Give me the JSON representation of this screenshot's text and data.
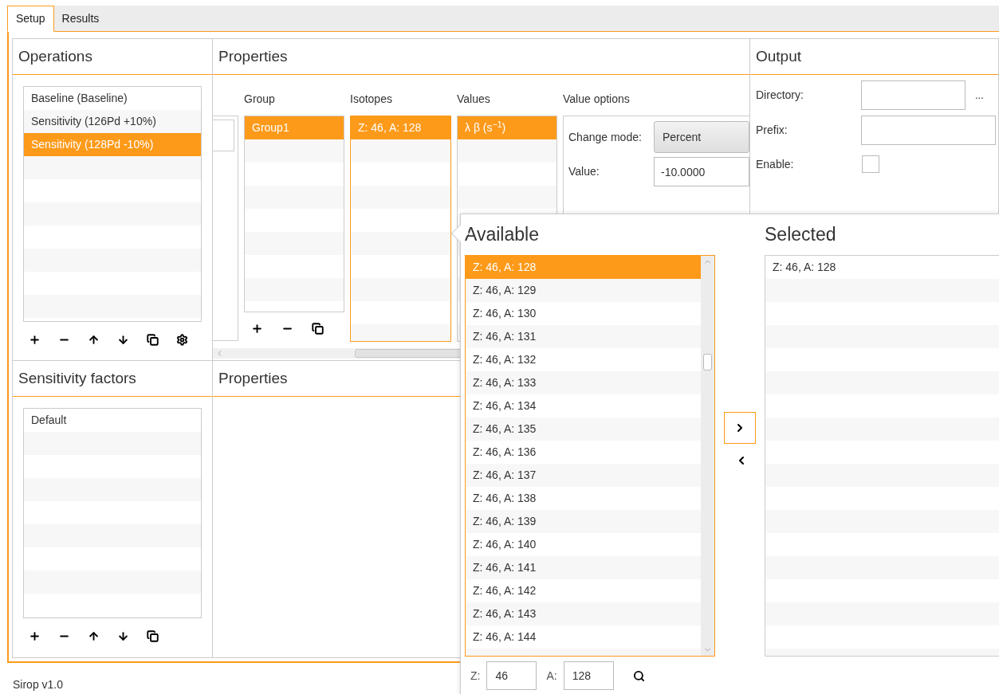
{
  "tabs": [
    {
      "label": "Setup",
      "selected": true
    },
    {
      "label": "Results",
      "selected": false
    }
  ],
  "operations": {
    "title": "Operations",
    "items": [
      {
        "label": "Baseline (Baseline)",
        "selected": false
      },
      {
        "label": "Sensitivity (126Pd +10%)",
        "selected": false
      },
      {
        "label": "Sensitivity (128Pd -10%)",
        "selected": true
      }
    ]
  },
  "properties": {
    "title": "Properties",
    "group": {
      "header": "Group",
      "items": [
        {
          "label": "Group1",
          "selected": true
        }
      ]
    },
    "isotopes": {
      "header": "Isotopes",
      "items": [
        {
          "label": "Z: 46, A: 128",
          "selected": true
        }
      ]
    },
    "values": {
      "header": "Values",
      "items": [
        {
          "label": "λ β (s$^{−1}$)",
          "selected": true
        }
      ]
    },
    "value_options": {
      "header": "Value options",
      "change_mode": {
        "label": "Change mode:",
        "value": "Percent"
      },
      "value": {
        "label": "Value:",
        "value": "-10.0000"
      }
    }
  },
  "output": {
    "title": "Output",
    "directory": {
      "label": "Directory:",
      "browse": "..."
    },
    "prefix": {
      "label": "Prefix:"
    },
    "enable": {
      "label": "Enable:",
      "checked": false
    }
  },
  "sensitivity_factors": {
    "title": "Sensitivity factors",
    "items": [
      {
        "label": "Default",
        "selected": false
      }
    ]
  },
  "properties_bottom": {
    "title": "Properties"
  },
  "status_bar": "Sirop v1.0",
  "picker": {
    "available_title": "Available",
    "available": [
      {
        "label": "Z: 46, A: 128",
        "selected": true
      },
      {
        "label": "Z: 46, A: 129",
        "selected": false
      },
      {
        "label": "Z: 46, A: 130",
        "selected": false
      },
      {
        "label": "Z: 46, A: 131",
        "selected": false
      },
      {
        "label": "Z: 46, A: 132",
        "selected": false
      },
      {
        "label": "Z: 46, A: 133",
        "selected": false
      },
      {
        "label": "Z: 46, A: 134",
        "selected": false
      },
      {
        "label": "Z: 46, A: 135",
        "selected": false
      },
      {
        "label": "Z: 46, A: 136",
        "selected": false
      },
      {
        "label": "Z: 46, A: 137",
        "selected": false
      },
      {
        "label": "Z: 46, A: 138",
        "selected": false
      },
      {
        "label": "Z: 46, A: 139",
        "selected": false
      },
      {
        "label": "Z: 46, A: 140",
        "selected": false
      },
      {
        "label": "Z: 46, A: 141",
        "selected": false
      },
      {
        "label": "Z: 46, A: 142",
        "selected": false
      },
      {
        "label": "Z: 46, A: 143",
        "selected": false
      },
      {
        "label": "Z: 46, A: 144",
        "selected": false
      }
    ],
    "selected_title": "Selected",
    "selected": [
      {
        "label": "Z: 46, A: 128",
        "selected": false
      }
    ],
    "z_field": {
      "label": "Z:",
      "value": "46"
    },
    "a_field": {
      "label": "A:",
      "value": "128"
    }
  }
}
